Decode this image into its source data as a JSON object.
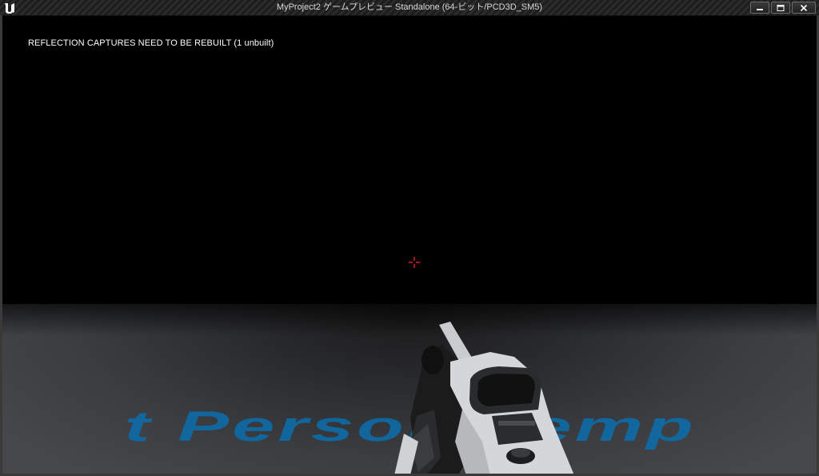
{
  "window": {
    "title": "MyProject2 ゲームプレビュー Standalone (64-ビット/PCD3D_SM5)",
    "controls": [
      "minimize",
      "maximize",
      "close"
    ],
    "logo": "unreal-engine-logo"
  },
  "viewport": {
    "message": "REFLECTION CAPTURES NEED TO BE REBUILT (1 unbuilt)",
    "floor_text": "t Person Temp",
    "crosshair_color": "#e0202a",
    "floor_text_color": "#0a6fae"
  }
}
